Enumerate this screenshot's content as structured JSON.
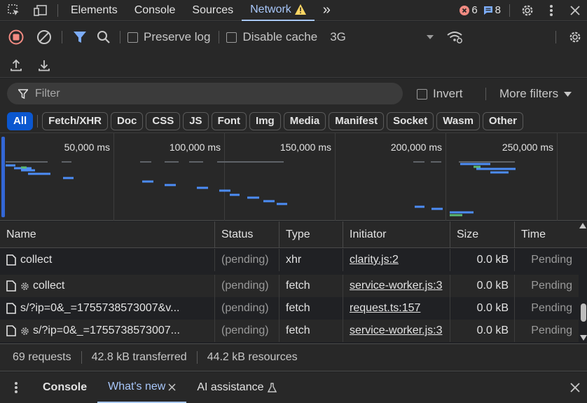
{
  "topbar": {
    "tabs": [
      {
        "label": "Elements"
      },
      {
        "label": "Console"
      },
      {
        "label": "Sources"
      },
      {
        "label": "Network"
      }
    ],
    "more": "»",
    "error_count": "6",
    "message_count": "8"
  },
  "toolbar": {
    "preserve_log": "Preserve log",
    "disable_cache": "Disable cache",
    "throttling": "3G"
  },
  "filter": {
    "placeholder": "Filter",
    "invert": "Invert",
    "more_filters": "More filters"
  },
  "type_filters": [
    "All",
    "Fetch/XHR",
    "Doc",
    "CSS",
    "JS",
    "Font",
    "Img",
    "Media",
    "Manifest",
    "Socket",
    "Wasm",
    "Other"
  ],
  "overview": {
    "ticks": [
      "50,000 ms",
      "100,000 ms",
      "150,000 ms",
      "200,000 ms",
      "250,000 ms"
    ]
  },
  "table": {
    "columns": [
      "Name",
      "Status",
      "Type",
      "Initiator",
      "Size",
      "Time"
    ],
    "rows": [
      {
        "name": "collect",
        "gear": false,
        "status": "(pending)",
        "type": "xhr",
        "initiator": "clarity.js:2",
        "size": "0.0 kB",
        "time": "Pending"
      },
      {
        "name": "collect",
        "gear": true,
        "status": "(pending)",
        "type": "fetch",
        "initiator": "service-worker.js:3",
        "size": "0.0 kB",
        "time": "Pending"
      },
      {
        "name": "s/?ip=0&_=1755738573007&v...",
        "gear": false,
        "status": "(pending)",
        "type": "fetch",
        "initiator": "request.ts:157",
        "size": "0.0 kB",
        "time": "Pending"
      },
      {
        "name": "s/?ip=0&_=1755738573007...",
        "gear": true,
        "status": "(pending)",
        "type": "fetch",
        "initiator": "service-worker.js:3",
        "size": "0.0 kB",
        "time": "Pending"
      }
    ]
  },
  "status": {
    "requests": "69 requests",
    "transferred": "42.8 kB transferred",
    "resources": "44.2 kB resources"
  },
  "drawer": {
    "tabs": [
      {
        "label": "Console"
      },
      {
        "label": "What's new"
      },
      {
        "label": "AI assistance"
      }
    ]
  },
  "colors": {
    "accent": "#a8c7fa",
    "record": "#f28b82",
    "warning": "#fdd663",
    "error_badge": "#f28b82",
    "message_badge": "#7cacf8",
    "active_chip": "#0b57d0",
    "waterfall_blue": "#4c8df6",
    "waterfall_green": "#5bb974"
  }
}
